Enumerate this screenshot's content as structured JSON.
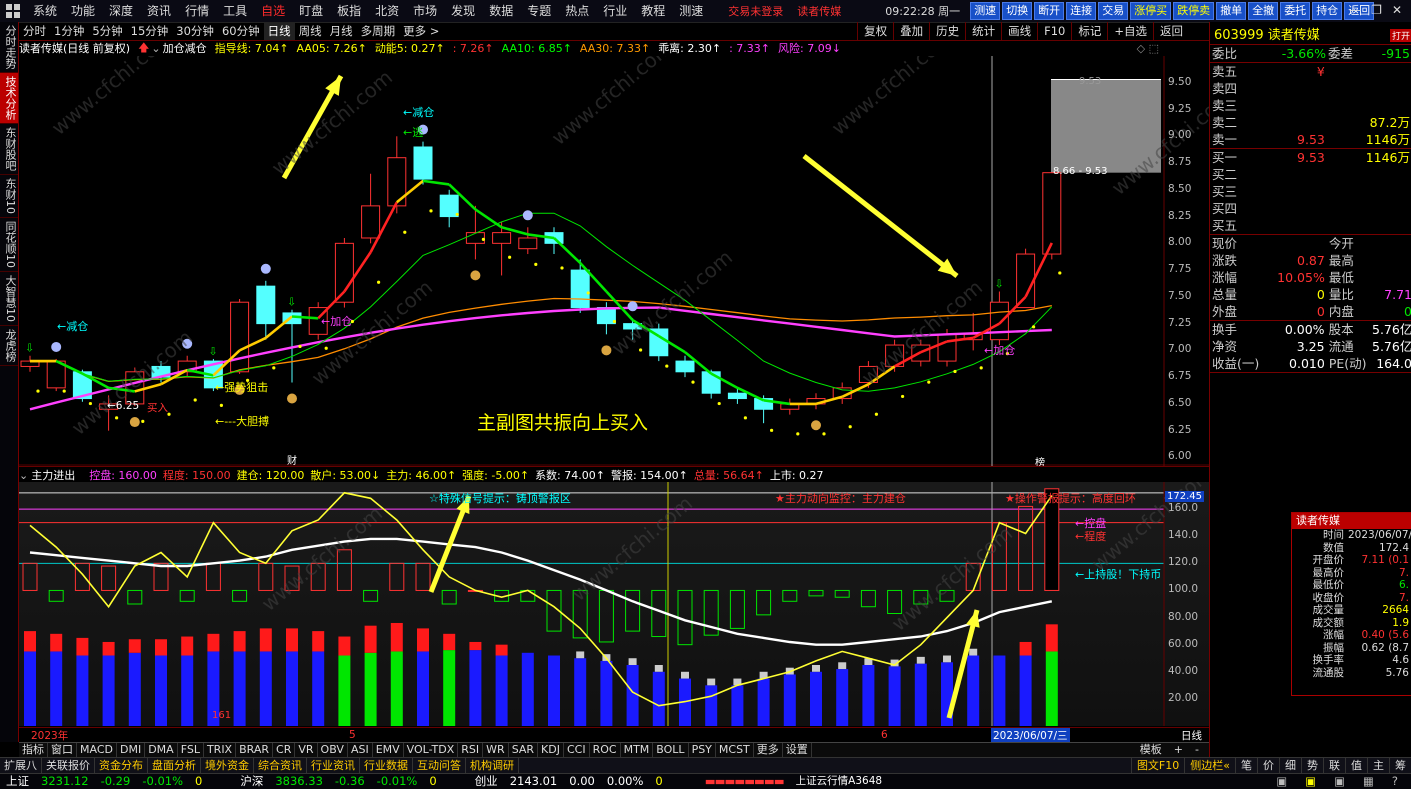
{
  "menu": [
    "系统",
    "功能",
    "深度",
    "资讯",
    "行情",
    "工具",
    "自选",
    "盯盘",
    "板指",
    "北资",
    "市场",
    "发现",
    "数据",
    "专题",
    "热点",
    "行业",
    "教程",
    "测速"
  ],
  "menu_active": "自选",
  "top_alert": [
    "交易未登录",
    "读者传媒"
  ],
  "clock": "09:22:28 周一",
  "top_buttons": [
    "测速",
    "切换",
    "断开",
    "连接",
    "交易",
    "涨停买",
    "跌停卖",
    "撤单",
    "全撤",
    "委托",
    "持仓",
    "返回"
  ],
  "left_tabs": [
    "分时走势",
    "技术分析",
    "东财股吧",
    "东财10",
    "同花顺10",
    "大智慧10",
    "龙虎榜"
  ],
  "left_tab_active": "技术分析",
  "periods": [
    "分时",
    "1分钟",
    "5分钟",
    "15分钟",
    "30分钟",
    "60分钟",
    "日线",
    "周线",
    "月线",
    "多周期",
    "更多 >"
  ],
  "period_selected": "日线",
  "period_right": [
    "复权",
    "叠加",
    "历史",
    "统计",
    "画线",
    "F10",
    "标记",
    "+自选",
    "返回"
  ],
  "indicator_line": {
    "name": "读者传媒(日线 前复权)",
    "mode": "加仓减仓",
    "items": [
      {
        "t": "指导线: 7.04↑",
        "c": "#ffff00"
      },
      {
        "t": "AA05: 7.26↑",
        "c": "#ffff00"
      },
      {
        "t": "动能5: 0.27↑",
        "c": "#ffff00"
      },
      {
        "t": ": 7.26↑",
        "c": "#ff3232"
      },
      {
        "t": "AA10: 6.85↑",
        "c": "#00ff00"
      },
      {
        "t": "AA30: 7.33↑",
        "c": "#ff9900"
      },
      {
        "t": "乖离: 2.30↑",
        "c": "#ffffff"
      },
      {
        "t": ": 7.33↑",
        "c": "#ff40ff"
      },
      {
        "t": "风险: 7.09↓",
        "c": "#ff40ff"
      }
    ]
  },
  "price_axis": [
    "9.50",
    "9.25",
    "9.00",
    "8.75",
    "8.50",
    "8.25",
    "8.00",
    "7.75",
    "7.50",
    "7.25",
    "7.00",
    "6.75",
    "6.50",
    "6.25",
    "6.00"
  ],
  "main_annotations": {
    "reduce1": "←减仓",
    "reduce2": "←减仓",
    "escape": "←逃",
    "add1": "←加仓",
    "add2": "←加仓",
    "strong": "←强势狙击",
    "bold": "←---大胆搏",
    "low": "←6.25",
    "buy": "买入",
    "price_top": "9.53",
    "price_range": "8.66 - 9.53",
    "caption": "主副图共振向上买入",
    "marker_cai": "财",
    "marker_bang": "榜",
    "watermark": "www.cfchi.com"
  },
  "sub_head": {
    "name": "主力进出",
    "items": [
      {
        "t": "控盘: 160.00",
        "c": "#ff40ff"
      },
      {
        "t": "程度: 150.00",
        "c": "#ff3232"
      },
      {
        "t": "建仓: 120.00",
        "c": "#ffff00"
      },
      {
        "t": "散户: 53.00↓",
        "c": "#ffff00"
      },
      {
        "t": "主力: 46.00↑",
        "c": "#ffff00"
      },
      {
        "t": "强度: -5.00↑",
        "c": "#ffff00"
      },
      {
        "t": "系数: 74.00↑",
        "c": "#ffffff"
      },
      {
        "t": "警报: 154.00↑",
        "c": "#ffffff"
      },
      {
        "t": "总量: 56.64↑",
        "c": "#ff3232"
      },
      {
        "t": "上市: 0.27",
        "c": "#ffffff"
      }
    ]
  },
  "sub_annotations": {
    "warn": "☆特殊信号提示：铸顶警报区",
    "main_warn": "★主力动向监控：主力建仓",
    "op_warn": "★操作警报提示：高度回环",
    "ctrl": "←控盘",
    "degree": "←程度",
    "hold": "←上持股！下持币",
    "axis_label": "172.45",
    "vol_label": "161"
  },
  "sub_axis": [
    "160.0",
    "140.0",
    "120.0",
    "100.0",
    "80.00",
    "60.00",
    "40.00",
    "20.00"
  ],
  "date_axis": [
    "2023年",
    "5",
    "6"
  ],
  "date_current": "2023/06/07/三",
  "date_right": "日线",
  "ind_tabs": [
    "指标",
    "窗口",
    "MACD",
    "DMI",
    "DMA",
    "FSL",
    "TRIX",
    "BRAR",
    "CR",
    "VR",
    "OBV",
    "ASI",
    "EMV",
    "VOL-TDX",
    "RSI",
    "WR",
    "SAR",
    "KDJ",
    "CCI",
    "ROC",
    "MTM",
    "BOLL",
    "PSY",
    "MCST",
    "更多",
    "设置"
  ],
  "ind_tabs_right": [
    "模板",
    "+",
    "-"
  ],
  "status1": [
    "扩展八",
    "关联报价",
    "资金分布",
    "盘面分析",
    "境外资金",
    "综合资讯",
    "行业资讯",
    "行业数据",
    "互动问答",
    "机构调研"
  ],
  "status1_right": [
    "图文F10",
    "侧边栏«",
    "笔",
    "价",
    "细",
    "势",
    "联",
    "值",
    "主",
    "筹"
  ],
  "status2": {
    "sh_name": "上证",
    "sh_val": "3231.12",
    "sh_chg": "-0.29",
    "sh_pct": "-0.01%",
    "sh_vol": "0",
    "sz_name": "沪深",
    "sz_val": "3836.33",
    "sz_chg": "-0.36",
    "sz_pct": "-0.01%",
    "sz_vol": "0",
    "cy_name": "创业",
    "cy_val": "2143.01",
    "cy_chg": "0.00",
    "cy_pct": "0.00%",
    "cy_vol": "0",
    "news": "上证云行情A3648"
  },
  "quote": {
    "code_name": "603999 读者传媒",
    "badge": "打开",
    "weibi_label": "委比",
    "weibi": "-3.66%",
    "weicha_label": "委差",
    "weicha": "-915",
    "asks": [
      {
        "l": "卖五",
        "p": "¥",
        "v": ""
      },
      {
        "l": "卖四",
        "p": "",
        "v": ""
      },
      {
        "l": "卖三",
        "p": "",
        "v": ""
      },
      {
        "l": "卖二",
        "p": "",
        "v": "87.2万"
      },
      {
        "l": "卖一",
        "p": "9.53",
        "v": "1146万"
      }
    ],
    "bids": [
      {
        "l": "买一",
        "p": "9.53",
        "v": "1146万"
      },
      {
        "l": "买二",
        "p": "",
        "v": ""
      },
      {
        "l": "买三",
        "p": "",
        "v": ""
      },
      {
        "l": "买四",
        "p": "",
        "v": ""
      },
      {
        "l": "买五",
        "p": "",
        "v": ""
      }
    ],
    "stats": [
      {
        "l1": "现价",
        "v1": "",
        "l2": "今开",
        "v2": "",
        "c1": "#fff",
        "c2": "#fff"
      },
      {
        "l1": "涨跌",
        "v1": "0.87",
        "l2": "最高",
        "v2": "",
        "c1": "#ff3232",
        "c2": "#ff3232"
      },
      {
        "l1": "涨幅",
        "v1": "10.05%",
        "l2": "最低",
        "v2": "",
        "c1": "#ff3232",
        "c2": "#ff3232"
      },
      {
        "l1": "总量",
        "v1": "0",
        "l2": "量比",
        "v2": "7.71",
        "c1": "#ffff00",
        "c2": "#ff40ff"
      },
      {
        "l1": "外盘",
        "v1": "0",
        "l2": "内盘",
        "v2": "0",
        "c1": "#ff3232",
        "c2": "#00e600"
      }
    ],
    "stats2": [
      {
        "l1": "换手",
        "v1": "0.00%",
        "l2": "股本",
        "v2": "5.76亿"
      },
      {
        "l1": "净资",
        "v1": "3.25",
        "l2": "流通",
        "v2": "5.76亿"
      },
      {
        "l1": "收益(一)",
        "v1": "0.010",
        "l2": "PE(动)",
        "v2": "164.0"
      }
    ]
  },
  "infobox": {
    "title": "读者传媒",
    "rows": [
      {
        "k": "时间",
        "v": "2023/06/07/",
        "c": "#ddd"
      },
      {
        "k": "数值",
        "v": "172.4",
        "c": "#ddd"
      },
      {
        "k": "开盘价",
        "v": "7.11 (0.1",
        "c": "#ff3232"
      },
      {
        "k": "最高价",
        "v": "7.",
        "c": "#ff3232"
      },
      {
        "k": "最低价",
        "v": "6.",
        "c": "#00e600"
      },
      {
        "k": "收盘价",
        "v": "7.",
        "c": "#ff3232"
      },
      {
        "k": "成交量",
        "v": "2664",
        "c": "#ffff00"
      },
      {
        "k": "成交额",
        "v": "1.9",
        "c": "#ffff00"
      },
      {
        "k": "涨幅",
        "v": "0.40 (5.6",
        "c": "#ff3232"
      },
      {
        "k": "振幅",
        "v": "0.62 (8.7",
        "c": "#ddd"
      },
      {
        "k": "换手率",
        "v": "4.6",
        "c": "#ddd"
      },
      {
        "k": "流通股",
        "v": "5.76",
        "c": "#ddd"
      }
    ]
  },
  "candles": [
    {
      "o": 6.85,
      "c": 6.9,
      "h": 6.95,
      "l": 6.8
    },
    {
      "o": 6.65,
      "c": 6.9,
      "h": 6.92,
      "l": 6.62
    },
    {
      "o": 6.8,
      "c": 6.55,
      "h": 6.82,
      "l": 6.52
    },
    {
      "o": 6.45,
      "c": 6.5,
      "h": 6.58,
      "l": 6.25
    },
    {
      "o": 6.5,
      "c": 6.8,
      "h": 6.84,
      "l": 6.48
    },
    {
      "o": 6.85,
      "c": 6.75,
      "h": 6.9,
      "l": 6.7
    },
    {
      "o": 6.8,
      "c": 6.9,
      "h": 6.95,
      "l": 6.76
    },
    {
      "o": 6.9,
      "c": 6.65,
      "h": 6.92,
      "l": 6.62
    },
    {
      "o": 6.8,
      "c": 7.45,
      "h": 7.48,
      "l": 6.78
    },
    {
      "o": 7.6,
      "c": 7.25,
      "h": 7.65,
      "l": 7.1
    },
    {
      "o": 7.35,
      "c": 7.25,
      "h": 7.38,
      "l": 6.7
    },
    {
      "o": 7.15,
      "c": 7.4,
      "h": 7.45,
      "l": 7.1
    },
    {
      "o": 7.45,
      "c": 8.0,
      "h": 8.05,
      "l": 7.4
    },
    {
      "o": 8.05,
      "c": 8.35,
      "h": 8.65,
      "l": 8.0
    },
    {
      "o": 8.35,
      "c": 8.8,
      "h": 9.0,
      "l": 8.28
    },
    {
      "o": 8.9,
      "c": 8.6,
      "h": 8.95,
      "l": 8.55
    },
    {
      "o": 8.45,
      "c": 8.25,
      "h": 8.5,
      "l": 8.15
    },
    {
      "o": 8.0,
      "c": 8.1,
      "h": 8.35,
      "l": 7.85
    },
    {
      "o": 8.0,
      "c": 8.1,
      "h": 8.2,
      "l": 7.7
    },
    {
      "o": 7.95,
      "c": 8.05,
      "h": 8.15,
      "l": 7.9
    },
    {
      "o": 8.1,
      "c": 8.0,
      "h": 8.15,
      "l": 7.9
    },
    {
      "o": 7.75,
      "c": 7.4,
      "h": 7.85,
      "l": 7.35
    },
    {
      "o": 7.4,
      "c": 7.25,
      "h": 7.45,
      "l": 7.15
    },
    {
      "o": 7.25,
      "c": 7.2,
      "h": 7.3,
      "l": 7.1
    },
    {
      "o": 7.2,
      "c": 6.95,
      "h": 7.25,
      "l": 6.9
    },
    {
      "o": 6.9,
      "c": 6.8,
      "h": 6.95,
      "l": 6.75
    },
    {
      "o": 6.8,
      "c": 6.6,
      "h": 6.82,
      "l": 6.55
    },
    {
      "o": 6.6,
      "c": 6.55,
      "h": 6.65,
      "l": 6.5
    },
    {
      "o": 6.55,
      "c": 6.45,
      "h": 6.58,
      "l": 6.32
    },
    {
      "o": 6.45,
      "c": 6.5,
      "h": 6.55,
      "l": 6.4
    },
    {
      "o": 6.5,
      "c": 6.55,
      "h": 6.6,
      "l": 6.45
    },
    {
      "o": 6.55,
      "c": 6.65,
      "h": 6.7,
      "l": 6.5
    },
    {
      "o": 6.7,
      "c": 6.85,
      "h": 6.9,
      "l": 6.65
    },
    {
      "o": 6.85,
      "c": 7.05,
      "h": 7.1,
      "l": 6.8
    },
    {
      "o": 6.9,
      "c": 7.05,
      "h": 7.1,
      "l": 6.85
    },
    {
      "o": 6.9,
      "c": 7.15,
      "h": 7.2,
      "l": 6.85
    },
    {
      "o": 7.1,
      "c": 7.15,
      "h": 7.35,
      "l": 7.0
    },
    {
      "o": 7.1,
      "c": 7.45,
      "h": 7.55,
      "l": 7.05
    },
    {
      "o": 7.4,
      "c": 7.9,
      "h": 7.95,
      "l": 7.4
    },
    {
      "o": 7.9,
      "c": 8.66,
      "h": 8.66,
      "l": 7.85
    }
  ]
}
